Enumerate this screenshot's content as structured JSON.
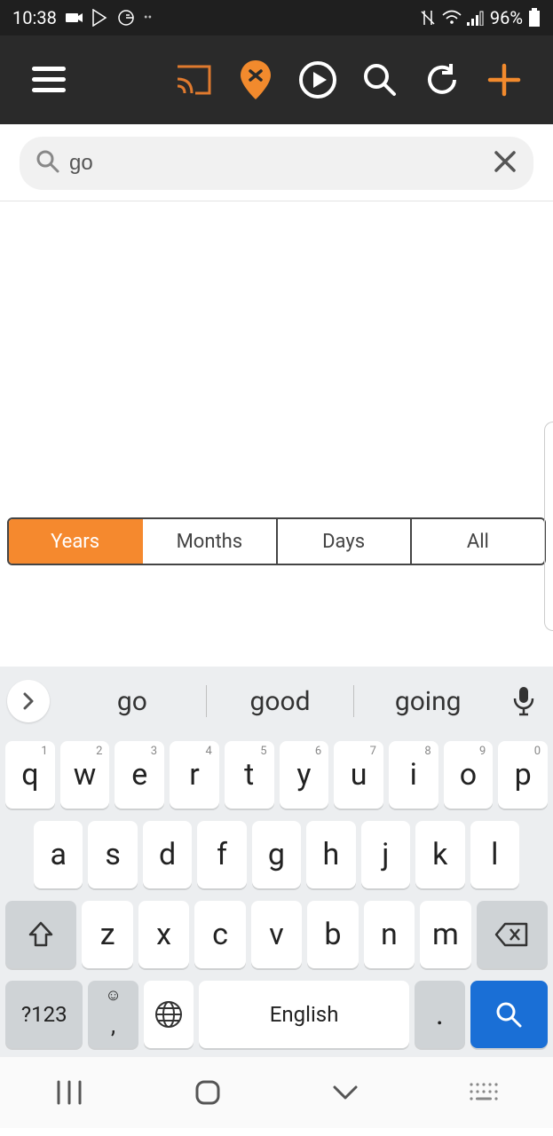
{
  "status": {
    "time": "10:38",
    "battery_pct": "96%"
  },
  "search": {
    "value": "go"
  },
  "tabs": {
    "items": [
      "Years",
      "Months",
      "Days",
      "All"
    ],
    "active_index": 0
  },
  "keyboard": {
    "suggestions": [
      "go",
      "good",
      "going"
    ],
    "rows": {
      "r1": [
        {
          "k": "q",
          "n": "1"
        },
        {
          "k": "w",
          "n": "2"
        },
        {
          "k": "e",
          "n": "3"
        },
        {
          "k": "r",
          "n": "4"
        },
        {
          "k": "t",
          "n": "5"
        },
        {
          "k": "y",
          "n": "6"
        },
        {
          "k": "u",
          "n": "7"
        },
        {
          "k": "i",
          "n": "8"
        },
        {
          "k": "o",
          "n": "9"
        },
        {
          "k": "p",
          "n": "0"
        }
      ],
      "r2": [
        "a",
        "s",
        "d",
        "f",
        "g",
        "h",
        "j",
        "k",
        "l"
      ],
      "r3": [
        "z",
        "x",
        "c",
        "v",
        "b",
        "n",
        "m"
      ]
    },
    "sym_label": "?123",
    "space_label": "English",
    "period_label": ".",
    "comma_label": ","
  }
}
